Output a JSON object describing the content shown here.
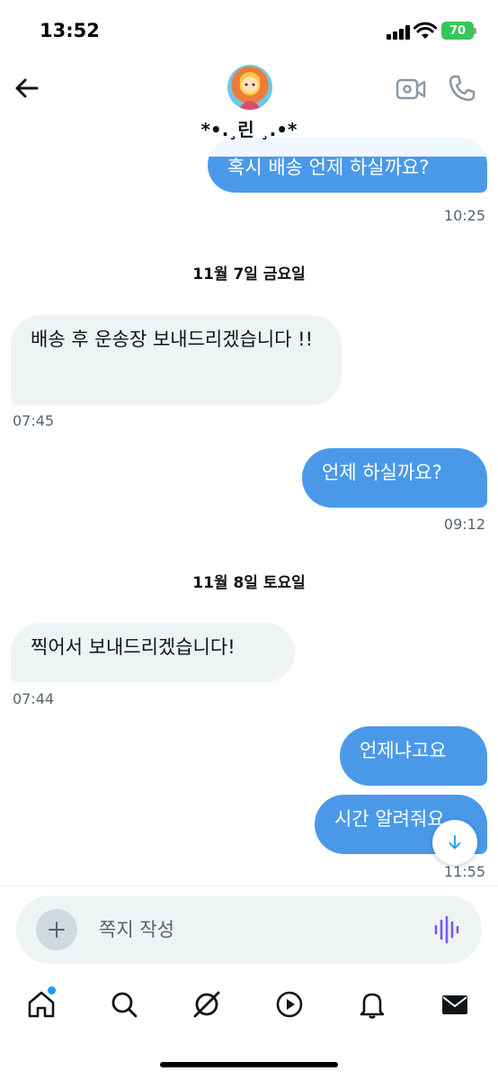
{
  "status_bar": {
    "time": "13:52",
    "battery": "70"
  },
  "header": {
    "contact_name": "*•.¸린 ¸.•*",
    "icons": {
      "back": "arrow-left-icon",
      "video": "video-camera-icon",
      "call": "phone-icon"
    }
  },
  "messages": [
    {
      "type": "out",
      "text": "혹시 배송 언제 하실까요?",
      "time": "10:25"
    },
    {
      "type": "date",
      "text": "11월 7일 금요일"
    },
    {
      "type": "in",
      "text": "배송 후 운송장 보내드리겠습니다 !!",
      "time": "07:45"
    },
    {
      "type": "out",
      "text": "언제 하실까요?",
      "time": "09:12"
    },
    {
      "type": "date",
      "text": "11월 8일 토요일"
    },
    {
      "type": "in",
      "text": "찍어서 보내드리겠습니다!",
      "time": "07:44"
    },
    {
      "type": "out",
      "text": "언제냐고요"
    },
    {
      "type": "out",
      "text": "시간 알려줘요",
      "time": "11:55"
    }
  ],
  "composer": {
    "placeholder": "쪽지 작성"
  },
  "tabbar": {
    "items": [
      "home-icon",
      "search-icon",
      "grok-icon",
      "play-icon",
      "bell-icon",
      "mail-icon"
    ],
    "active": "mail-icon",
    "home_has_notification_dot": true
  },
  "colors": {
    "accent": "#1d9bf0",
    "outgoing_bubble": "#4a99e9",
    "incoming_bubble": "#eff3f4",
    "muted_text": "#536471"
  }
}
